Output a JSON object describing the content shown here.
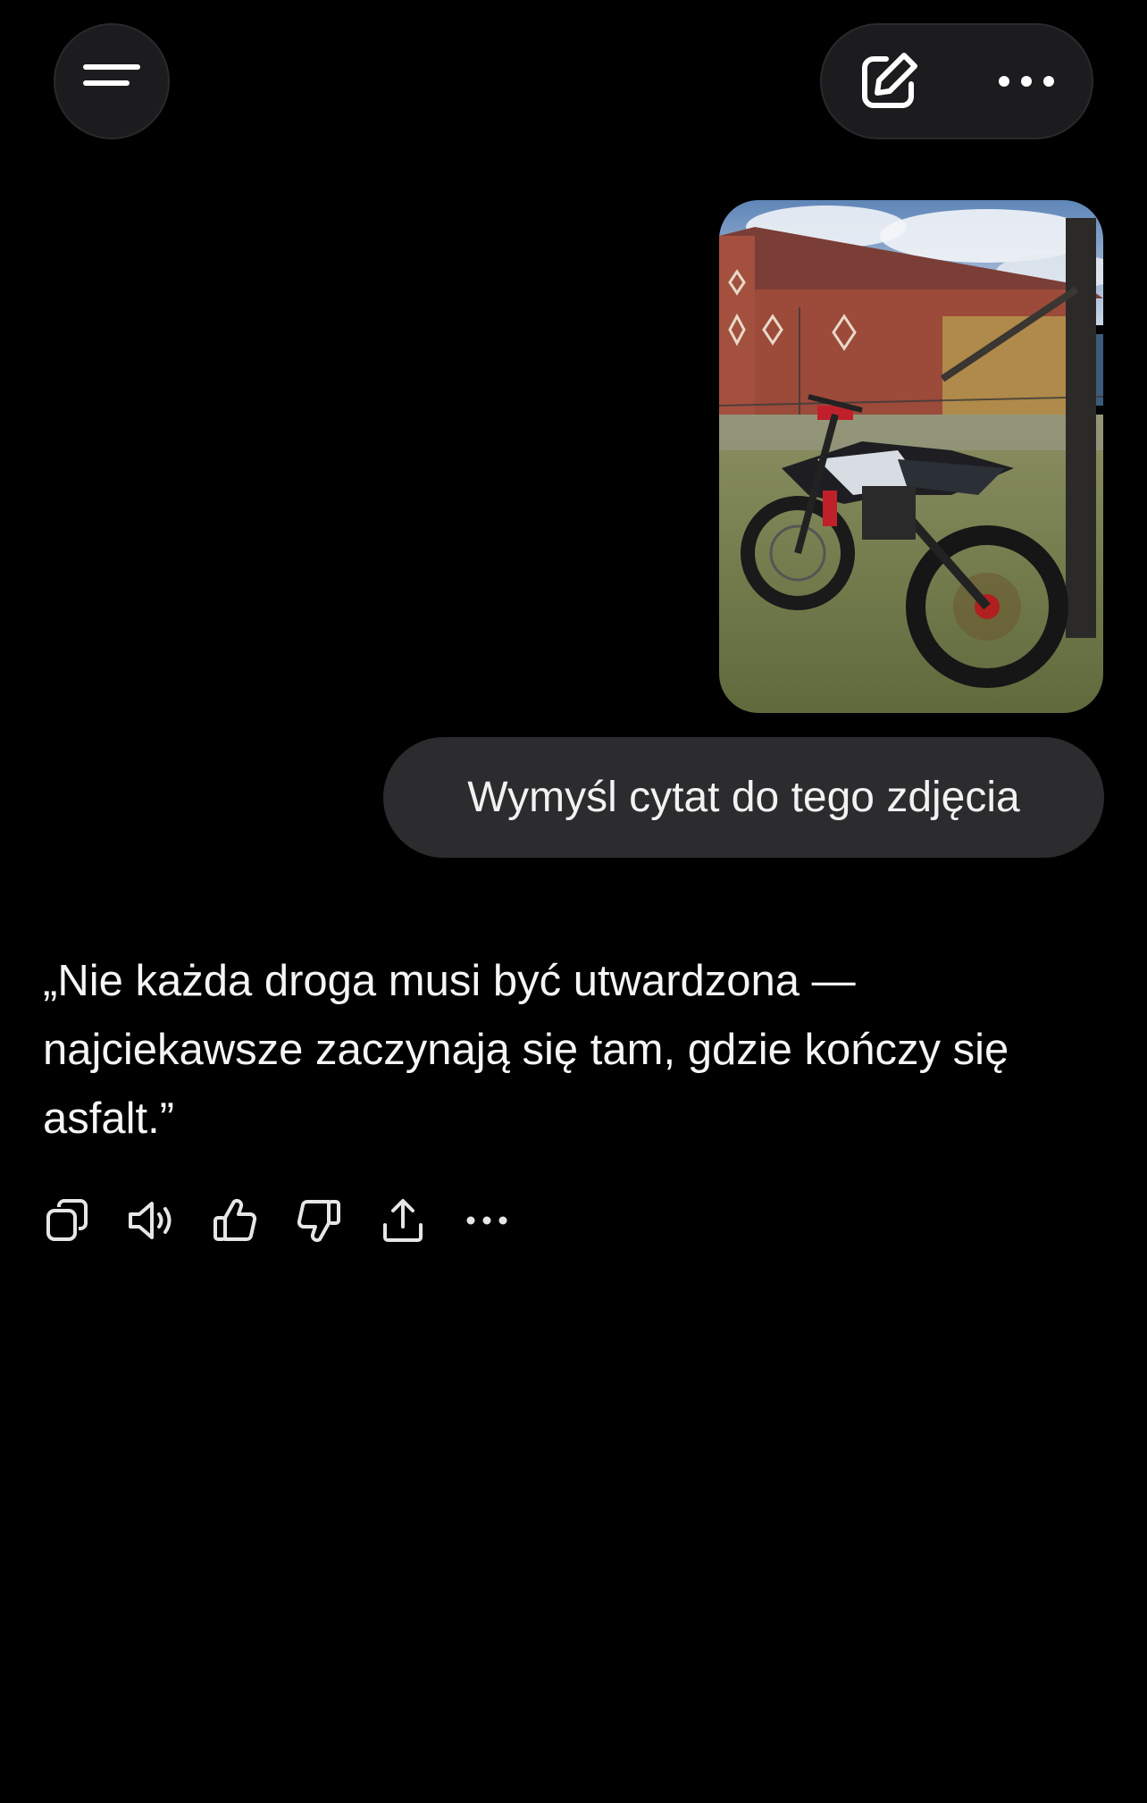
{
  "header": {
    "menu_icon": "hamburger-menu-icon",
    "edit_icon": "compose-edit-icon",
    "more_icon": "more-horizontal-icon"
  },
  "chat": {
    "user_image": {
      "description": "photo-attachment",
      "icon": "image"
    },
    "user_message": "Wymyśl cytat do tego zdjęcia",
    "assistant_message": "„Nie każda droga musi być utwardzona — najciekawsze zaczynają się tam, gdzie kończy się asfalt.”",
    "actions": [
      {
        "name": "copy",
        "icon": "copy-icon"
      },
      {
        "name": "read-aloud",
        "icon": "speaker-icon"
      },
      {
        "name": "good-response",
        "icon": "thumbs-up-icon"
      },
      {
        "name": "bad-response",
        "icon": "thumbs-down-icon"
      },
      {
        "name": "share",
        "icon": "share-icon"
      },
      {
        "name": "more",
        "icon": "more-horizontal-icon"
      }
    ]
  },
  "colors": {
    "background": "#000000",
    "pill": "#1c1c1e",
    "user_bubble": "#2c2c2e",
    "text": "#f5f5f5"
  }
}
